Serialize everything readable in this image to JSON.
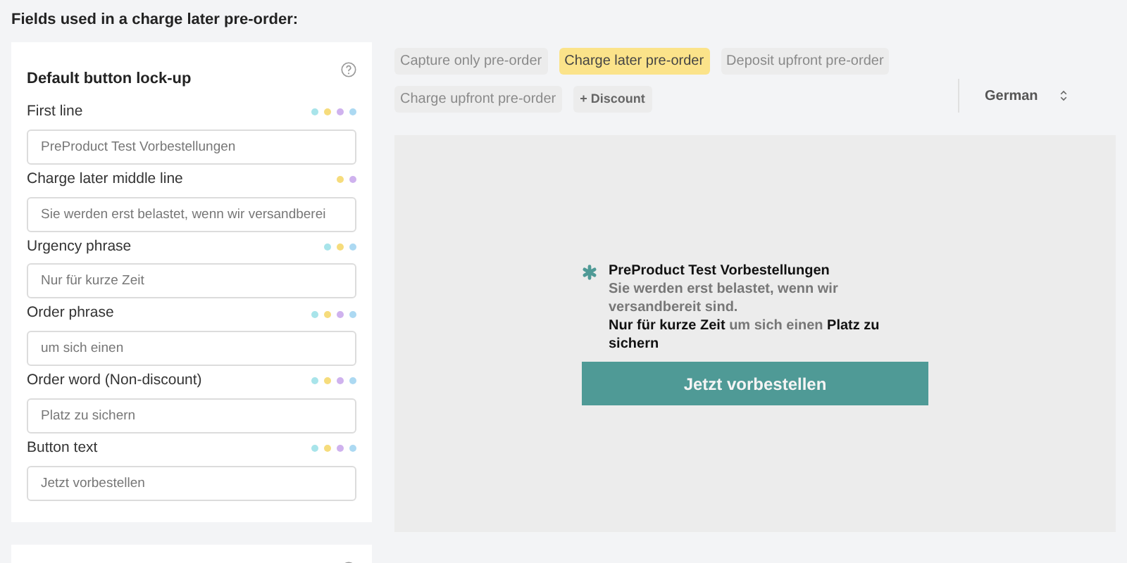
{
  "heading": "Fields used in a charge later pre-order:",
  "lockup_card": {
    "title": "Default button lock-up",
    "fields": [
      {
        "label": "First line",
        "value": "PreProduct Test Vorbestellungen",
        "dots": [
          {
            "color": "#a8e4ea"
          },
          {
            "color": "#f6dc7c"
          },
          {
            "color": "#cfb2ee"
          },
          {
            "color": "#acd9f2"
          }
        ]
      },
      {
        "label": "Charge later middle line",
        "value": "Sie werden erst belastet, wenn wir versandberei",
        "dots": [
          {
            "color": "#f6dc7c"
          },
          {
            "color": "#cfb2ee"
          }
        ]
      },
      {
        "label": "Urgency phrase",
        "value": "Nur für kurze Zeit",
        "dots": [
          {
            "color": "#a8e4ea"
          },
          {
            "color": "#f6dc7c"
          },
          {
            "color": "#acd9f2"
          }
        ]
      },
      {
        "label": "Order phrase",
        "value": "um sich einen",
        "dots": [
          {
            "color": "#a8e4ea"
          },
          {
            "color": "#f6dc7c"
          },
          {
            "color": "#cfb2ee"
          },
          {
            "color": "#acd9f2"
          }
        ]
      },
      {
        "label": "Order word (Non-discount)",
        "value": "Platz zu sichern",
        "dots": [
          {
            "color": "#a8e4ea"
          },
          {
            "color": "#f6dc7c"
          },
          {
            "color": "#cfb2ee"
          },
          {
            "color": "#acd9f2"
          }
        ]
      },
      {
        "label": "Button text",
        "value": "Jetzt vorbestellen",
        "dots": [
          {
            "color": "#a8e4ea"
          },
          {
            "color": "#f6dc7c"
          },
          {
            "color": "#cfb2ee"
          },
          {
            "color": "#acd9f2"
          }
        ]
      }
    ]
  },
  "tabs": [
    {
      "label": "Capture only pre-order",
      "kind": "tab",
      "selected": false
    },
    {
      "label": "Charge later pre-order",
      "kind": "tab",
      "selected": true
    },
    {
      "label": "Deposit upfront pre-order",
      "kind": "tab",
      "selected": false
    },
    {
      "label": "Charge upfront pre-order",
      "kind": "tab",
      "selected": false
    },
    {
      "label": "+ Discount",
      "kind": "toggle",
      "selected": false
    }
  ],
  "language": {
    "value": "German"
  },
  "preview": {
    "title": "PreProduct Test Vorbestellungen",
    "middle_line": "Sie werden erst belastet, wenn wir versandbereit sind.",
    "urgency_line": "**Nur für kurze Zeit** um sich einen **Platz zu sichern**",
    "button": "Jetzt vorbestellen"
  }
}
